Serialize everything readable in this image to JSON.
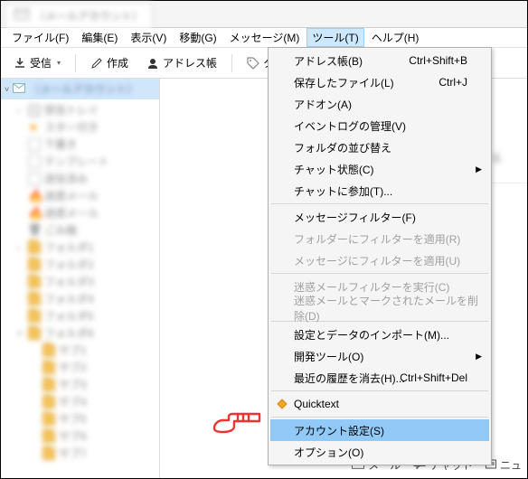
{
  "tab_title": "（メールアカウント）",
  "menubar": {
    "file": "ファイル(F)",
    "edit": "編集(E)",
    "view": "表示(V)",
    "go": "移動(G)",
    "message": "メッセージ(M)",
    "tools": "ツール(T)",
    "help": "ヘルプ(H)"
  },
  "toolbar": {
    "receive": "受信",
    "compose": "作成",
    "address": "アドレス帳",
    "tag": "タグ"
  },
  "account_row": "（メールアカウント）",
  "tree_items": [
    {
      "icon": "inbox",
      "label": "受信トレイ",
      "twisty": true
    },
    {
      "icon": "star",
      "label": "スター付き"
    },
    {
      "icon": "draft",
      "label": "下書き"
    },
    {
      "icon": "template",
      "label": "テンプレート"
    },
    {
      "icon": "sent",
      "label": "送信済み"
    },
    {
      "icon": "junk",
      "label": "迷惑メール"
    },
    {
      "icon": "junk",
      "label": "迷惑メール"
    },
    {
      "icon": "trash",
      "label": "ごみ箱"
    },
    {
      "icon": "folder",
      "label": "フォルダ1",
      "twisty": true
    },
    {
      "icon": "folder",
      "label": "フォルダ2"
    },
    {
      "icon": "folder",
      "label": "フォルダ3"
    },
    {
      "icon": "folder",
      "label": "フォルダ4"
    },
    {
      "icon": "folder",
      "label": "フォルダ5"
    },
    {
      "icon": "folder",
      "label": "フォルダ6",
      "twisty": true,
      "open": true
    },
    {
      "icon": "folder",
      "label": "サブ1",
      "indent": true
    },
    {
      "icon": "folder",
      "label": "サブ2",
      "indent": true
    },
    {
      "icon": "folder",
      "label": "サブ3",
      "indent": true
    },
    {
      "icon": "folder",
      "label": "サブ4",
      "indent": true
    },
    {
      "icon": "folder",
      "label": "サブ5",
      "indent": true
    },
    {
      "icon": "folder",
      "label": "サブ6",
      "indent": true
    },
    {
      "icon": "folder",
      "label": "サブ7",
      "indent": true
    }
  ],
  "dropdown": {
    "items": [
      {
        "label": "アドレス帳(B)",
        "shortcut": "Ctrl+Shift+B"
      },
      {
        "label": "保存したファイル(L)",
        "shortcut": "Ctrl+J"
      },
      {
        "label": "アドオン(A)"
      },
      {
        "label": "イベントログの管理(V)"
      },
      {
        "label": "フォルダの並び替え"
      },
      {
        "label": "チャット状態(C)",
        "submenu": true
      },
      {
        "label": "チャットに参加(T)..."
      },
      {
        "sep": true
      },
      {
        "label": "メッセージフィルター(F)"
      },
      {
        "label": "フォルダーにフィルターを適用(R)",
        "disabled": true
      },
      {
        "label": "メッセージにフィルターを適用(U)",
        "disabled": true
      },
      {
        "sep": true
      },
      {
        "label": "迷惑メールフィルターを実行(C)",
        "disabled": true
      },
      {
        "label": "迷惑メールとマークされたメールを削除(D)",
        "disabled": true
      },
      {
        "sep": true
      },
      {
        "label": "設定とデータのインポート(M)..."
      },
      {
        "label": "開発ツール(O)",
        "submenu": true
      },
      {
        "label": "最近の履歴を消去(H)...",
        "shortcut": "Ctrl+Shift+Del"
      },
      {
        "sep": true
      },
      {
        "label": "Quicktext",
        "icon": "quicktext"
      },
      {
        "sep": true
      },
      {
        "label": "アカウント設定(S)",
        "highlight": true
      },
      {
        "label": "オプション(O)"
      }
    ]
  },
  "right": {
    "row1": "する"
  },
  "bottom": {
    "mail": "メール",
    "chat": "チャット",
    "news": "ニュ"
  }
}
